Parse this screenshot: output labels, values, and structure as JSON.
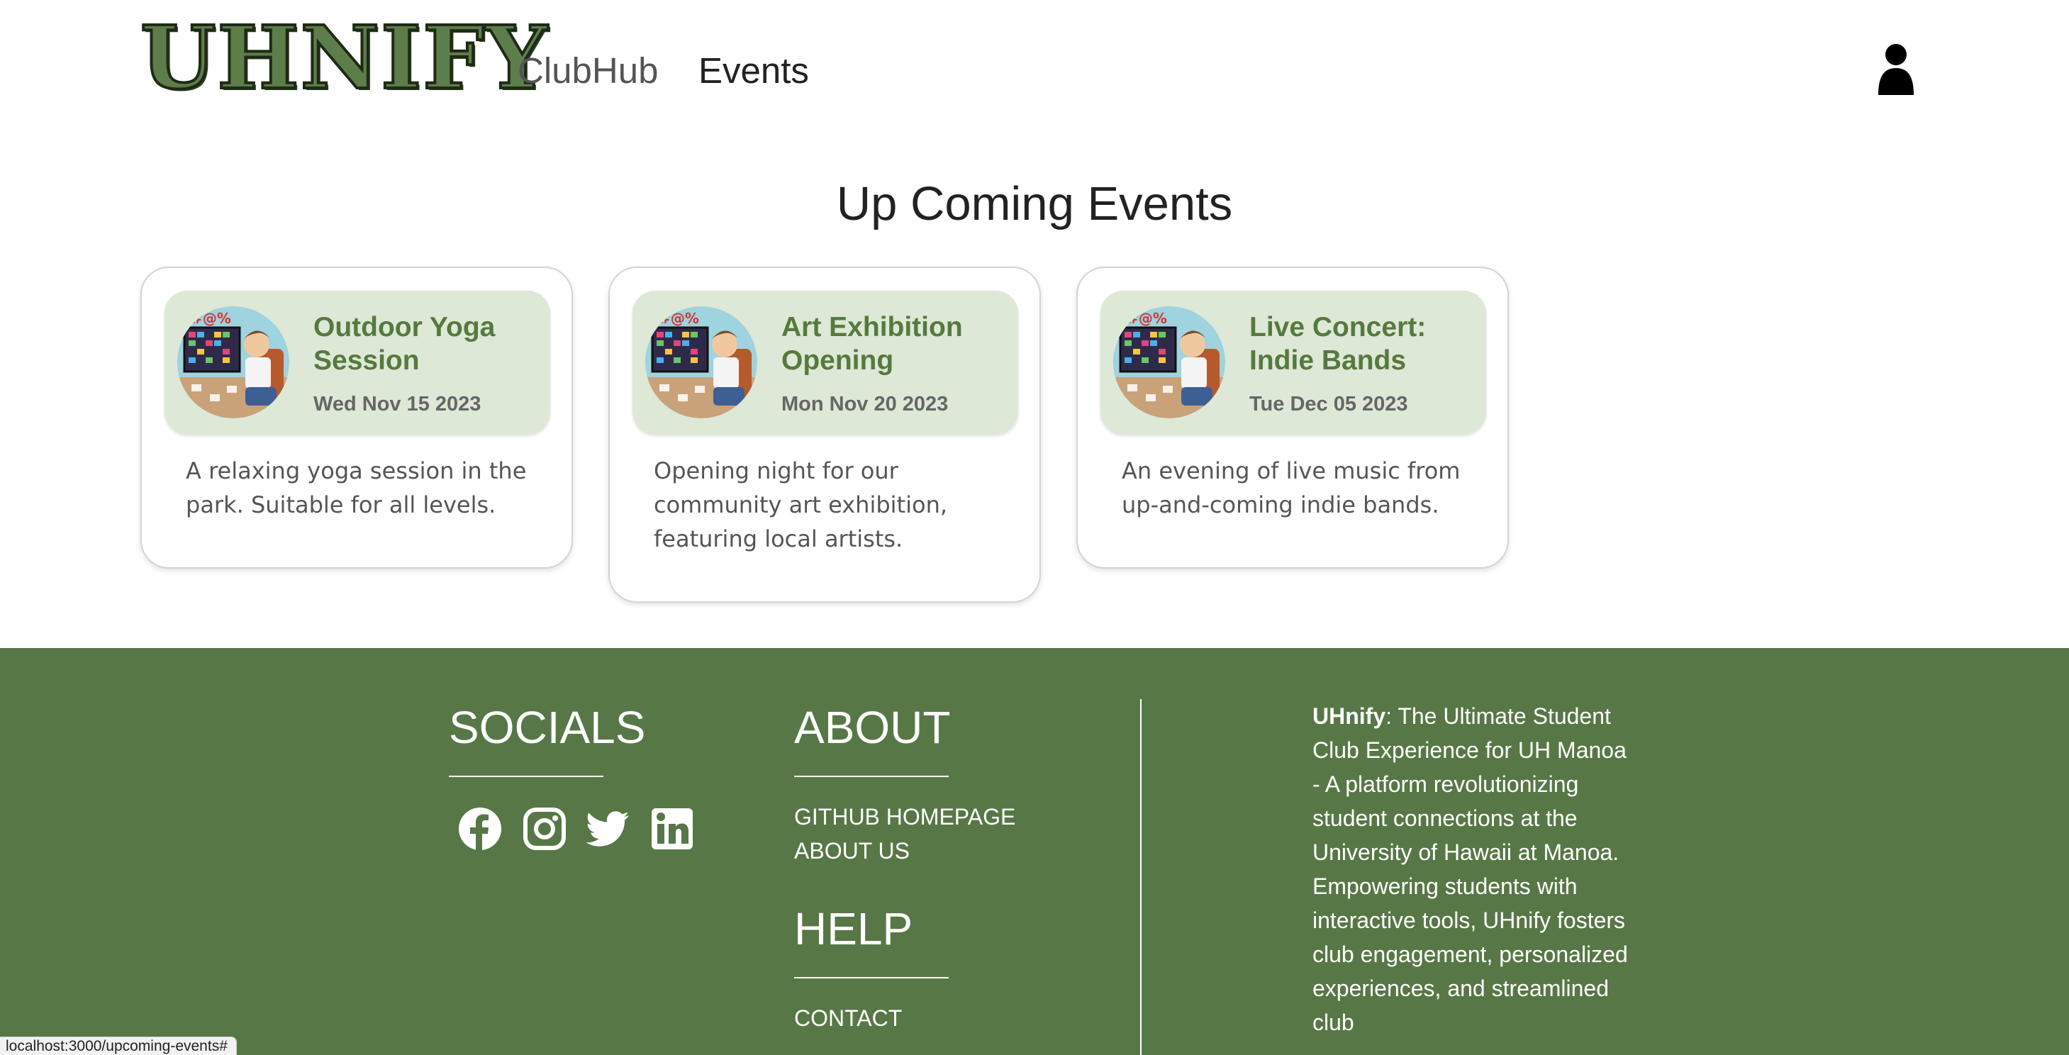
{
  "navbar": {
    "logo_text": "UHNIFY",
    "links": [
      {
        "label": "ClubHub"
      },
      {
        "label": "Events"
      }
    ],
    "user_icon": "user-icon"
  },
  "page": {
    "title": "Up Coming Events"
  },
  "events": [
    {
      "title": "Outdoor Yoga Session",
      "date": "Wed Nov 15 2023",
      "description": "A relaxing yoga session in the park. Suitable for all levels."
    },
    {
      "title": "Art Exhibition Opening",
      "date": "Mon Nov 20 2023",
      "description": "Opening night for our community art exhibition, featuring local artists."
    },
    {
      "title": "Live Concert: Indie Bands",
      "date": "Tue Dec 05 2023",
      "description": "An evening of live music from up-and-coming indie bands."
    }
  ],
  "footer": {
    "socials": {
      "heading": "SOCIALS",
      "icons": [
        "facebook-icon",
        "instagram-icon",
        "twitter-icon",
        "linkedin-icon"
      ]
    },
    "about": {
      "heading": "ABOUT",
      "links": [
        "GITHUB HOMEPAGE",
        "ABOUT US"
      ]
    },
    "help": {
      "heading": "HELP",
      "links": [
        "CONTACT"
      ]
    },
    "description": {
      "brand": "UHnify",
      "text": ": The Ultimate Student Club Experience for UH Manoa - A platform revolutionizing student connections at the University of Hawaii at Manoa. Empowering students with interactive tools, UHnify fosters club engagement, personalized experiences, and streamlined club"
    }
  },
  "status_bar": {
    "url": "localhost:3000/upcoming-events#"
  },
  "colors": {
    "footer_bg": "#587746",
    "card_header_bg": "#dde8d6",
    "card_title": "#56793f"
  }
}
